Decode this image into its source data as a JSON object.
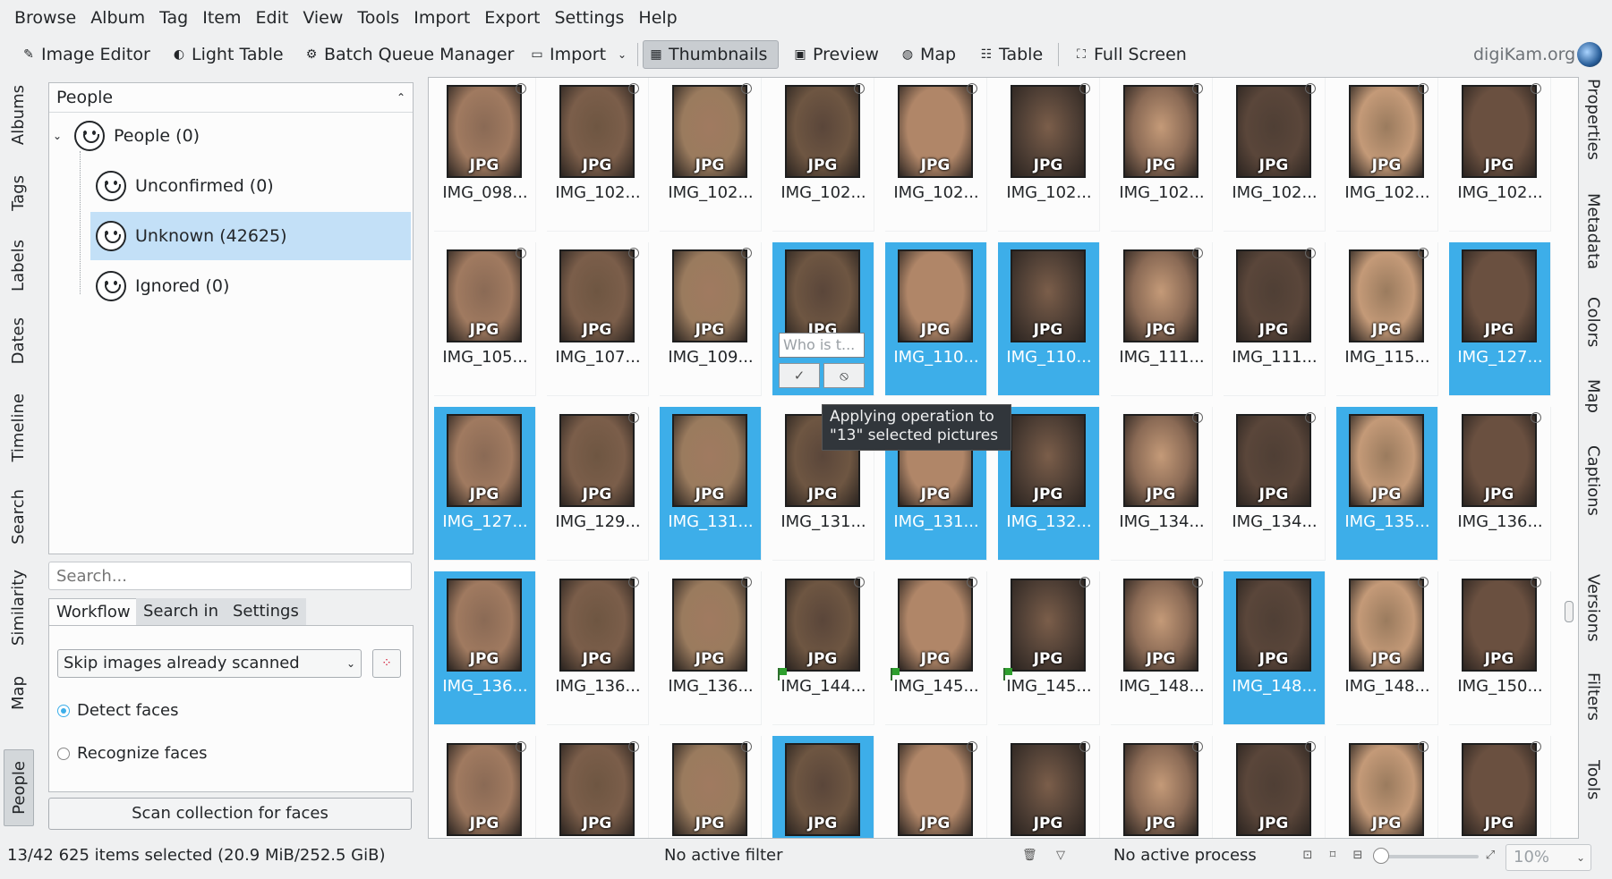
{
  "menubar": [
    "Browse",
    "Album",
    "Tag",
    "Item",
    "Edit",
    "View",
    "Tools",
    "Import",
    "Export",
    "Settings",
    "Help"
  ],
  "toolbar": {
    "image_editor": "Image Editor",
    "light_table": "Light Table",
    "batch_queue": "Batch Queue Manager",
    "import": "Import",
    "thumbnails": "Thumbnails",
    "preview": "Preview",
    "map": "Map",
    "table": "Table",
    "full_screen": "Full Screen",
    "brand": "digiKam.org"
  },
  "left_tabs": [
    "Albums",
    "Tags",
    "Labels",
    "Dates",
    "Timeline",
    "Search",
    "Similarity",
    "Map",
    "People"
  ],
  "right_tabs": [
    "Properties",
    "Metadata",
    "Colors",
    "Map",
    "Captions",
    "Versions",
    "Filters",
    "Tools"
  ],
  "people_panel": {
    "header": "People",
    "root": "People (0)",
    "items": [
      "Unconfirmed (0)",
      "Unknown (42625)",
      "Ignored (0)"
    ],
    "selected_item": "Unknown (42625)"
  },
  "search": {
    "placeholder": "Search..."
  },
  "settings_tabs": [
    "Workflow",
    "Search in",
    "Settings"
  ],
  "workflow": {
    "select_value": "Skip images already scanned",
    "detect_faces": "Detect faces",
    "recognize_faces": "Recognize faces",
    "detect_checked": true,
    "scan_button": "Scan collection for faces"
  },
  "thumbnails": [
    {
      "name": "IMG_098...",
      "selected": false
    },
    {
      "name": "IMG_102...",
      "selected": false
    },
    {
      "name": "IMG_102...",
      "selected": false
    },
    {
      "name": "IMG_102...",
      "selected": false
    },
    {
      "name": "IMG_102...",
      "selected": false
    },
    {
      "name": "IMG_102...",
      "selected": false
    },
    {
      "name": "IMG_102...",
      "selected": false
    },
    {
      "name": "IMG_102...",
      "selected": false
    },
    {
      "name": "IMG_102...",
      "selected": false
    },
    {
      "name": "IMG_102...",
      "selected": false
    },
    {
      "name": "IMG_105...",
      "selected": false
    },
    {
      "name": "IMG_107...",
      "selected": false
    },
    {
      "name": "IMG_109...",
      "selected": false
    },
    {
      "name": "",
      "selected": true
    },
    {
      "name": "IMG_110...",
      "selected": true
    },
    {
      "name": "IMG_110...",
      "selected": true
    },
    {
      "name": "IMG_111...",
      "selected": false
    },
    {
      "name": "IMG_111...",
      "selected": false
    },
    {
      "name": "IMG_115...",
      "selected": false
    },
    {
      "name": "IMG_127...",
      "selected": true
    },
    {
      "name": "IMG_127...",
      "selected": true
    },
    {
      "name": "IMG_129...",
      "selected": false
    },
    {
      "name": "IMG_131...",
      "selected": true
    },
    {
      "name": "IMG_131...",
      "selected": false
    },
    {
      "name": "IMG_131...",
      "selected": true
    },
    {
      "name": "IMG_132...",
      "selected": true
    },
    {
      "name": "IMG_134...",
      "selected": false
    },
    {
      "name": "IMG_134...",
      "selected": false
    },
    {
      "name": "IMG_135...",
      "selected": true
    },
    {
      "name": "IMG_136...",
      "selected": false
    },
    {
      "name": "IMG_136...",
      "selected": true
    },
    {
      "name": "IMG_136...",
      "selected": false
    },
    {
      "name": "IMG_136...",
      "selected": false
    },
    {
      "name": "IMG_144...",
      "selected": false
    },
    {
      "name": "IMG_145...",
      "selected": false
    },
    {
      "name": "IMG_145...",
      "selected": false
    },
    {
      "name": "IMG_148...",
      "selected": false
    },
    {
      "name": "IMG_148...",
      "selected": true
    },
    {
      "name": "IMG_148...",
      "selected": false
    },
    {
      "name": "IMG_150...",
      "selected": false
    },
    {
      "name": "",
      "selected": false
    },
    {
      "name": "",
      "selected": false
    },
    {
      "name": "",
      "selected": false
    },
    {
      "name": "",
      "selected": true
    },
    {
      "name": "",
      "selected": false
    },
    {
      "name": "",
      "selected": false
    },
    {
      "name": "",
      "selected": false
    },
    {
      "name": "",
      "selected": false
    },
    {
      "name": "",
      "selected": false
    },
    {
      "name": "",
      "selected": false
    }
  ],
  "thumb_badge": "JPG",
  "face_popup": {
    "placeholder": "Who is t...",
    "confirm_icon": "check-icon",
    "reject_icon": "block-icon"
  },
  "tooltip": {
    "line1": "Applying operation to",
    "line2": "\"13\" selected pictures"
  },
  "status": {
    "selection": "13/42 625 items selected (20.9 MiB/252.5 GiB)",
    "filter": "No active filter",
    "process": "No active process",
    "zoom": "10%"
  },
  "colors": {
    "selection": "#3daee9",
    "accent": "#3daee9"
  }
}
